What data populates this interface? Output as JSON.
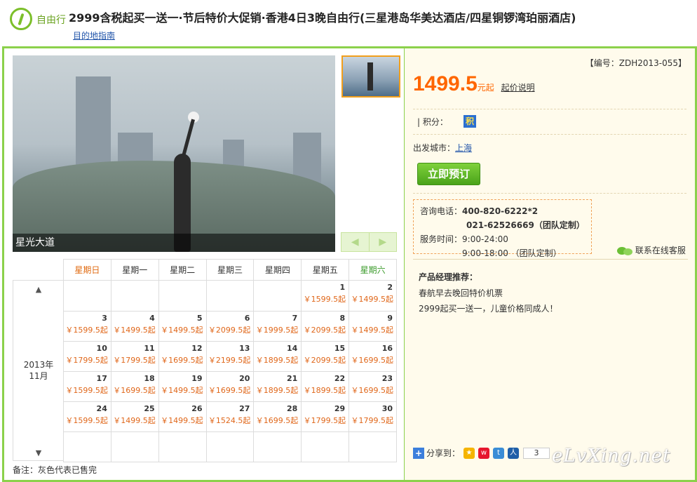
{
  "header": {
    "tag": "自由行",
    "title": "2999含税起买一送一·节后特价大促销·香港4日3晚自由行(三星港岛华美达酒店/四星铜锣湾珀丽酒店)",
    "guide_link": "目的地指南"
  },
  "gallery": {
    "caption": "星光大道",
    "prev_label": "◀",
    "next_label": "▶"
  },
  "calendar": {
    "year_month": "2013年\n11月",
    "up": "▲",
    "down": "▼",
    "weekdays": [
      "星期日",
      "星期一",
      "星期二",
      "星期三",
      "星期四",
      "星期五",
      "星期六"
    ],
    "weeks": [
      [
        {
          "d": "",
          "p": ""
        },
        {
          "d": "",
          "p": ""
        },
        {
          "d": "",
          "p": ""
        },
        {
          "d": "",
          "p": ""
        },
        {
          "d": "",
          "p": ""
        },
        {
          "d": "1",
          "p": "￥1599.5起"
        },
        {
          "d": "2",
          "p": "￥1499.5起"
        }
      ],
      [
        {
          "d": "3",
          "p": "￥1599.5起"
        },
        {
          "d": "4",
          "p": "￥1499.5起"
        },
        {
          "d": "5",
          "p": "￥1499.5起"
        },
        {
          "d": "6",
          "p": "￥2099.5起"
        },
        {
          "d": "7",
          "p": "￥1999.5起"
        },
        {
          "d": "8",
          "p": "￥2099.5起"
        },
        {
          "d": "9",
          "p": "￥1499.5起"
        }
      ],
      [
        {
          "d": "10",
          "p": "￥1799.5起"
        },
        {
          "d": "11",
          "p": "￥1799.5起"
        },
        {
          "d": "12",
          "p": "￥1699.5起"
        },
        {
          "d": "13",
          "p": "￥2199.5起"
        },
        {
          "d": "14",
          "p": "￥1899.5起"
        },
        {
          "d": "15",
          "p": "￥2099.5起"
        },
        {
          "d": "16",
          "p": "￥1699.5起"
        }
      ],
      [
        {
          "d": "17",
          "p": "￥1599.5起"
        },
        {
          "d": "18",
          "p": "￥1699.5起"
        },
        {
          "d": "19",
          "p": "￥1499.5起"
        },
        {
          "d": "20",
          "p": "￥1699.5起"
        },
        {
          "d": "21",
          "p": "￥1899.5起"
        },
        {
          "d": "22",
          "p": "￥1899.5起"
        },
        {
          "d": "23",
          "p": "￥1699.5起"
        }
      ],
      [
        {
          "d": "24",
          "p": "￥1599.5起"
        },
        {
          "d": "25",
          "p": "￥1499.5起"
        },
        {
          "d": "26",
          "p": "￥1499.5起"
        },
        {
          "d": "27",
          "p": "￥1524.5起"
        },
        {
          "d": "28",
          "p": "￥1699.5起"
        },
        {
          "d": "29",
          "p": "￥1799.5起"
        },
        {
          "d": "30",
          "p": "￥1799.5起"
        }
      ],
      [
        {
          "d": "",
          "p": ""
        },
        {
          "d": "",
          "p": ""
        },
        {
          "d": "",
          "p": ""
        },
        {
          "d": "",
          "p": ""
        },
        {
          "d": "",
          "p": ""
        },
        {
          "d": "",
          "p": ""
        },
        {
          "d": "",
          "p": ""
        }
      ]
    ],
    "note": "备注：灰色代表已售完"
  },
  "product": {
    "code": "【编号：ZDH2013-055】",
    "price": "1499.5",
    "price_unit": "元起",
    "price_link": "起价说明",
    "points_label": "| 积分：",
    "points_badge": "积",
    "city_label": "出发城市：",
    "city": "上海",
    "book_button": "立即预订",
    "contact": {
      "phone_label": "咨询电话：",
      "phone1": "400-820-6222*2",
      "phone2": "021-62526669（团队定制）",
      "hours_label": "服务时间：",
      "hours1": "9:00-24:00",
      "hours2": "9:00-18:00 （团队定制）"
    },
    "online_service": "联系在线客服",
    "recommend_title": "产品经理推荐：",
    "recommend_lines": [
      "春航早去晚回特价机票",
      "2999起买一送一，儿童价格同成人！"
    ],
    "share_label": "分享到：",
    "share_count": "3",
    "watermark": "eLvXing.net"
  },
  "colors": {
    "accent_green": "#8bd14b",
    "price_orange": "#ff6600",
    "link_blue": "#2255aa"
  }
}
